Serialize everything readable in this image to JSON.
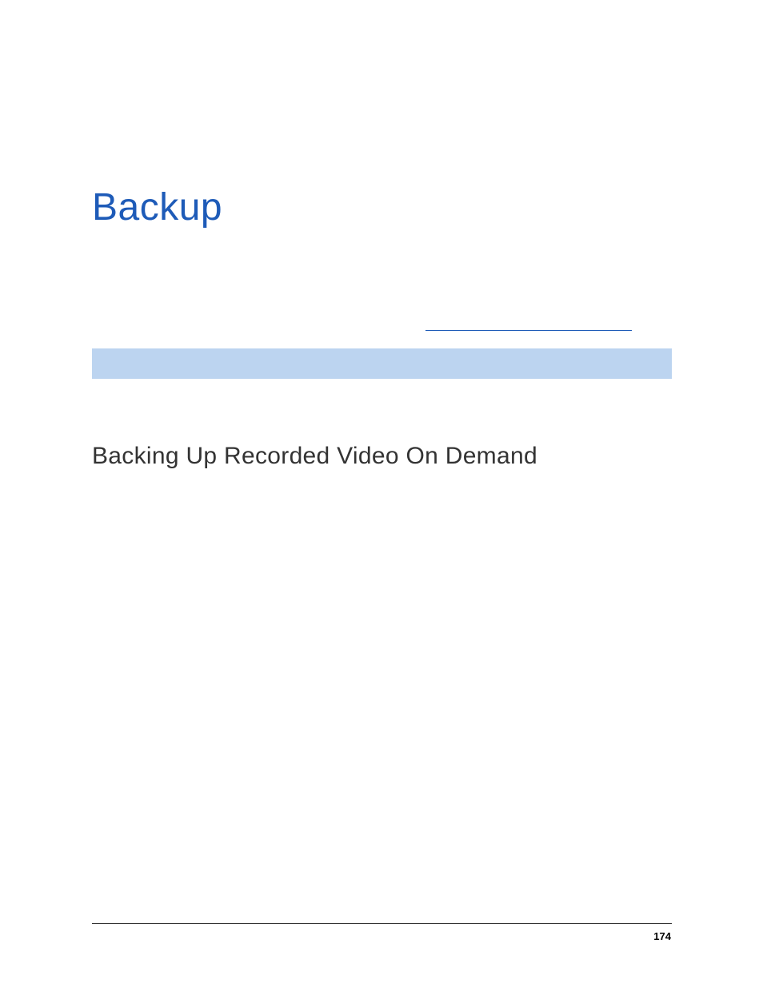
{
  "chapter": {
    "title": "Backup"
  },
  "section": {
    "title": "Backing Up Recorded Video On Demand"
  },
  "footer": {
    "page_number": "174"
  }
}
